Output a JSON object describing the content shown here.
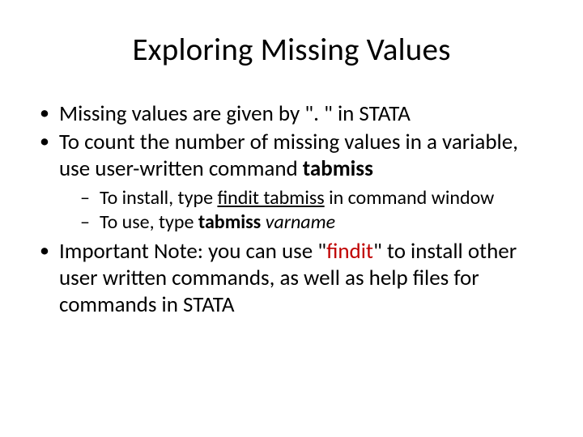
{
  "title": "Exploring Missing Values",
  "b1_a": "Missing values are given by \". \" in STATA",
  "b2_a": "To count the number of missing values in a variable, use user-written command ",
  "b2_b": "tabmiss",
  "s1_a": "To install, type ",
  "s1_b": "findit tabmiss",
  "s1_c": " in command window",
  "s2_a": "To use, type ",
  "s2_b": "tabmiss",
  "s2_c": " ",
  "s2_d": "varname",
  "b3_a": "Important Note: you can use \"",
  "b3_b": "findit",
  "b3_c": "\" to install other user written commands, as well as help files for commands in STATA"
}
